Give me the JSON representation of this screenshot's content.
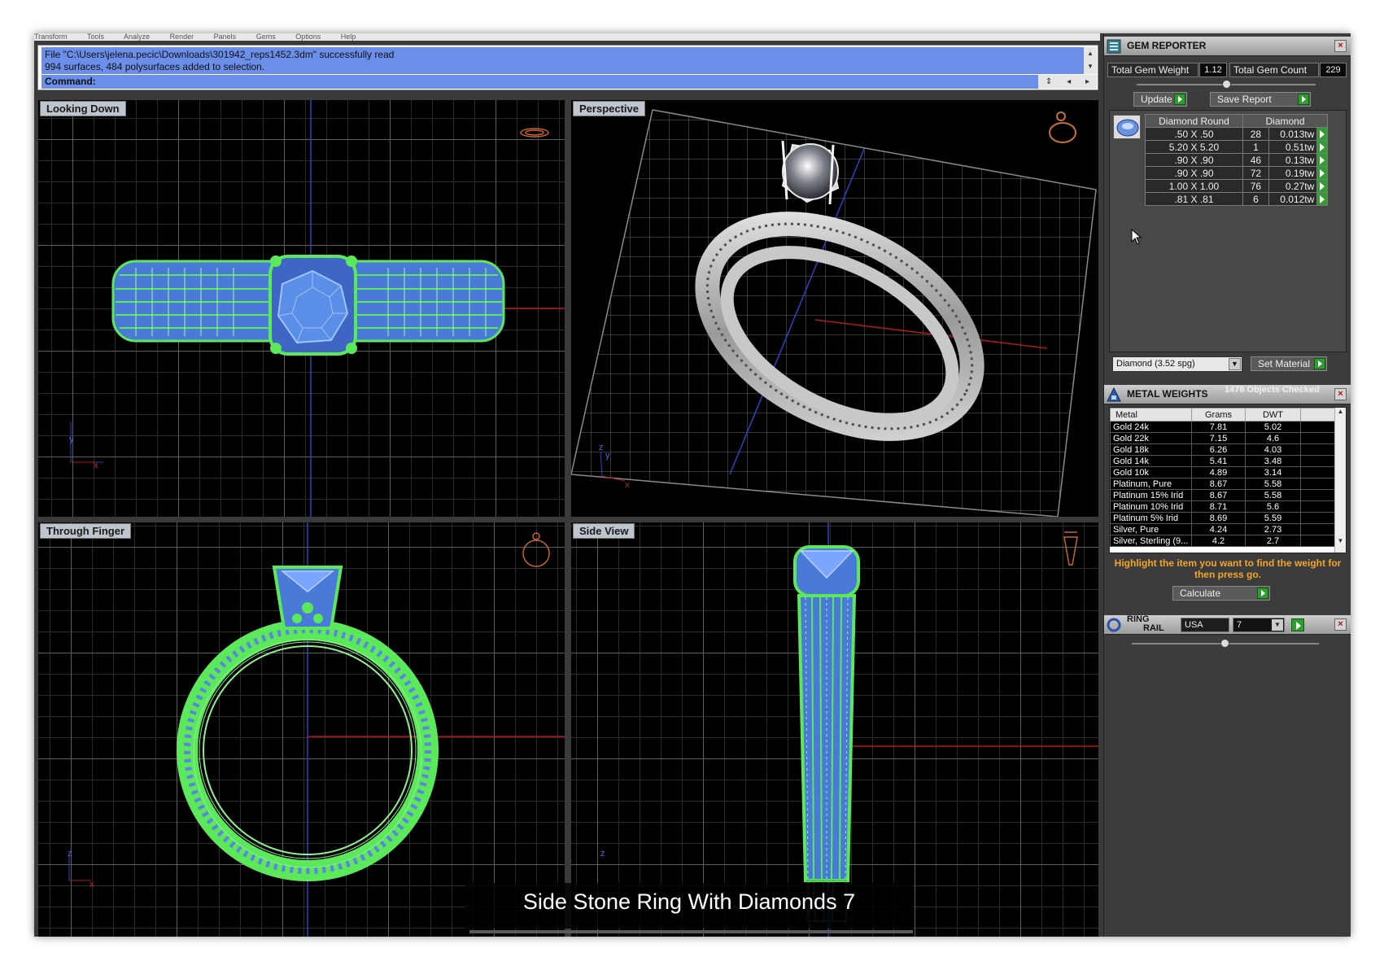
{
  "menu": {
    "items": [
      "Transform",
      "Tools",
      "Analyze",
      "Render",
      "Panels",
      "Gems",
      "Options",
      "Help"
    ]
  },
  "command": {
    "history_line1": "File \"C:\\Users\\jelena.pecic\\Downloads\\301942_reps1452.3dm\" successfully read",
    "history_line2": "994 surfaces, 484 polysurfaces added to selection.",
    "prompt": "Command:"
  },
  "viewports": {
    "top": "Looking Down",
    "perspective": "Perspective",
    "front": "Through Finger",
    "side": "Side View"
  },
  "caption": "Side Stone Ring With Diamonds 7",
  "gem_reporter": {
    "title": "GEM REPORTER",
    "total_weight_label": "Total Gem Weight",
    "total_weight": "1.12",
    "total_count_label": "Total Gem Count",
    "total_count": "229",
    "update_label": "Update",
    "save_label": "Save Report",
    "columns": [
      "Diamond Round",
      "Diamond"
    ],
    "rows": [
      {
        "size": ".50 X .50",
        "count": "28",
        "weight": "0.013tw"
      },
      {
        "size": "5.20 X 5.20",
        "count": "1",
        "weight": "0.51tw"
      },
      {
        "size": ".90 X .90",
        "count": "46",
        "weight": "0.13tw"
      },
      {
        "size": ".90 X .90",
        "count": "72",
        "weight": "0.19tw"
      },
      {
        "size": "1.00 X 1.00",
        "count": "76",
        "weight": "0.27tw"
      },
      {
        "size": ".81 X .81",
        "count": "6",
        "weight": "0.012tw"
      }
    ],
    "material": "Diamond    (3.52 spg)",
    "set_material_label": "Set Material"
  },
  "metal_weights": {
    "title": "METAL WEIGHTS",
    "objects_checked": "1478 Objects Checked",
    "columns": [
      "Metal",
      "Grams",
      "DWT"
    ],
    "rows": [
      {
        "metal": "Gold 24k",
        "grams": "7.81",
        "dwt": "5.02"
      },
      {
        "metal": "Gold 22k",
        "grams": "7.15",
        "dwt": "4.6"
      },
      {
        "metal": "Gold 18k",
        "grams": "6.26",
        "dwt": "4.03"
      },
      {
        "metal": "Gold 14k",
        "grams": "5.41",
        "dwt": "3.48"
      },
      {
        "metal": "Gold 10k",
        "grams": "4.89",
        "dwt": "3.14"
      },
      {
        "metal": "Platinum, Pure",
        "grams": "8.67",
        "dwt": "5.58"
      },
      {
        "metal": "Platinum 15% Irid",
        "grams": "8.67",
        "dwt": "5.58"
      },
      {
        "metal": "Platinum 10% Irid",
        "grams": "8.71",
        "dwt": "5.6"
      },
      {
        "metal": "Platinum 5% Irid",
        "grams": "8.69",
        "dwt": "5.59"
      },
      {
        "metal": "Silver, Pure",
        "grams": "4.24",
        "dwt": "2.73"
      },
      {
        "metal": "Silver, Sterling (9...",
        "grams": "4.2",
        "dwt": "2.7"
      }
    ],
    "hint": "Highlight the item you want to find the weight for then press go.",
    "calculate_label": "Calculate"
  },
  "ring_rail": {
    "title_line1": "RING",
    "title_line2": "RAIL",
    "standard": "USA",
    "size": "7"
  },
  "colors": {
    "wire_green": "#66ee66",
    "wire_blue": "#7aa6ff",
    "command_blue": "#6b8fe8",
    "hint_orange": "#f2a62a",
    "go_green": "#2f9d2f"
  }
}
